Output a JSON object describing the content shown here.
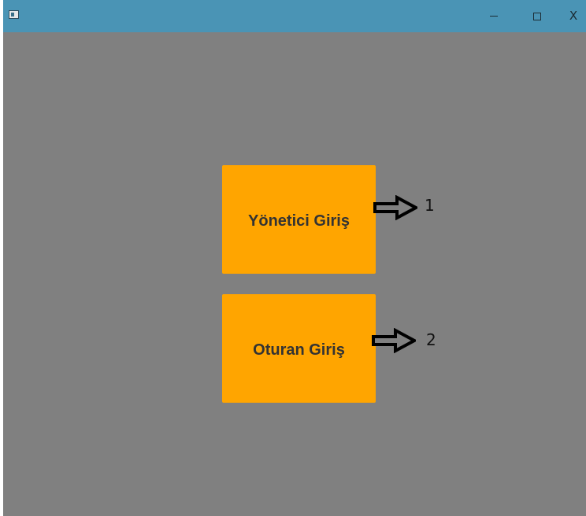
{
  "window": {
    "title": "",
    "controls": {
      "minimize": "minimize",
      "maximize": "maximize",
      "close": "X"
    }
  },
  "main": {
    "buttons": [
      {
        "label": "Yönetici Giriş",
        "callout": "1"
      },
      {
        "label": "Oturan Giriş",
        "callout": "2"
      }
    ]
  },
  "colors": {
    "titlebar": "#4a94b5",
    "background": "#808080",
    "button": "#ffa500",
    "button_text": "#333333"
  }
}
